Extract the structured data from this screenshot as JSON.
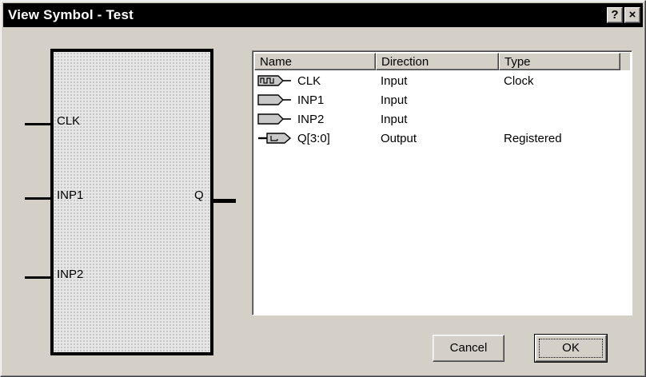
{
  "window": {
    "title": "View Symbol - Test",
    "help_glyph": "?",
    "close_glyph": "×"
  },
  "symbol": {
    "inputs": [
      "CLK",
      "INP1",
      "INP2"
    ],
    "output": "Q"
  },
  "list": {
    "columns": [
      "Name",
      "Direction",
      "Type"
    ],
    "rows": [
      {
        "icon": "clock-input-icon",
        "name": "CLK",
        "direction": "Input",
        "type": "Clock"
      },
      {
        "icon": "input-pin-icon",
        "name": "INP1",
        "direction": "Input",
        "type": ""
      },
      {
        "icon": "input-pin-icon",
        "name": "INP2",
        "direction": "Input",
        "type": ""
      },
      {
        "icon": "registered-output-icon",
        "name": "Q[3:0]",
        "direction": "Output",
        "type": "Registered"
      }
    ]
  },
  "buttons": {
    "cancel": "Cancel",
    "ok": "OK"
  }
}
